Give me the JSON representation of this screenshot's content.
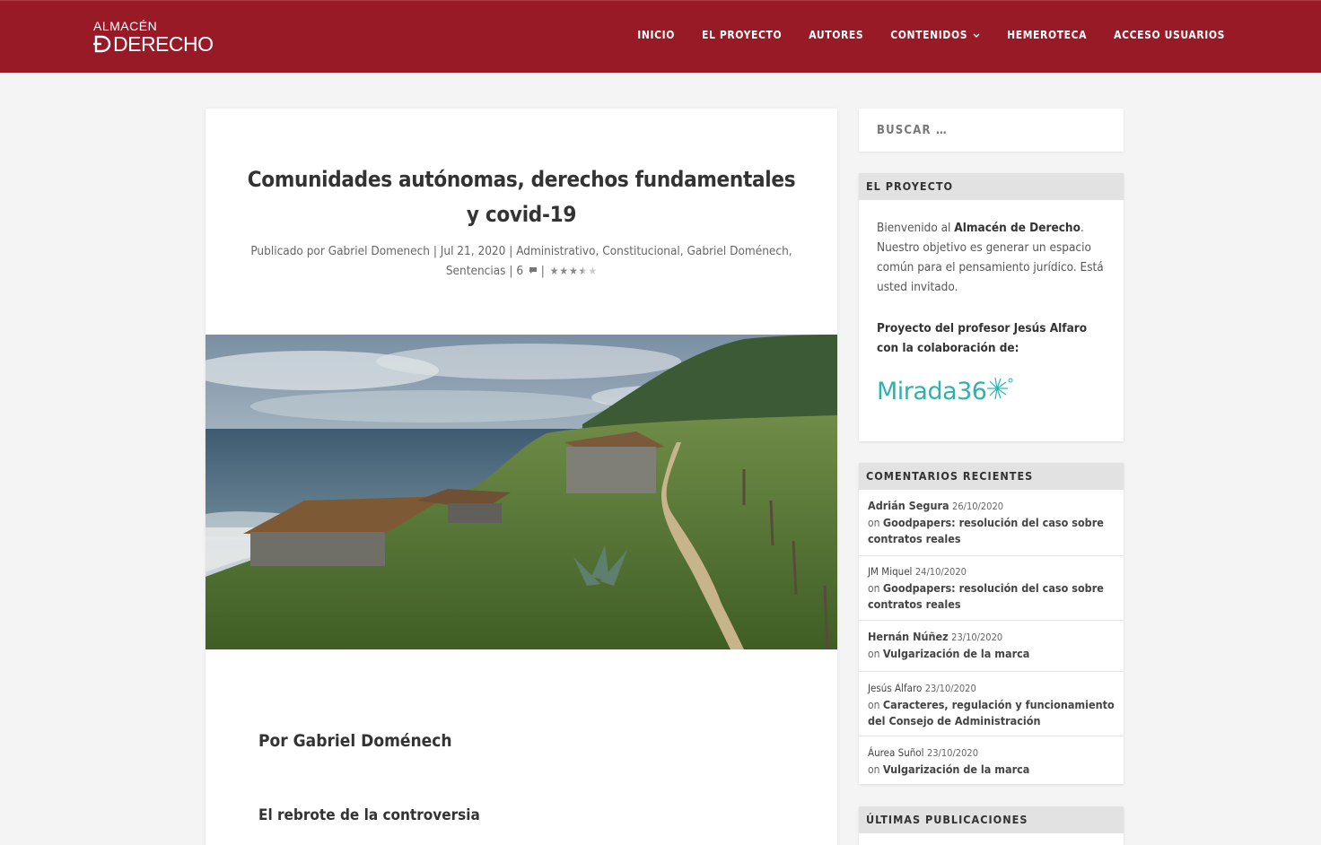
{
  "brand": {
    "line1": "ALMACÉN",
    "line2": "DERECHO",
    "color": "#981a26"
  },
  "nav": [
    {
      "label": "INICIO"
    },
    {
      "label": "EL PROYECTO"
    },
    {
      "label": "AUTORES"
    },
    {
      "label": "CONTENIDOS",
      "icon": "chevron-down-icon"
    },
    {
      "label": "HEMEROTECA"
    },
    {
      "label": "ACCESO USUARIOS"
    }
  ],
  "article": {
    "title": "Comunidades autónomas, derechos fundamentales y covid-19",
    "meta": {
      "prefix": "Publicado por ",
      "author": "Gabriel Domenech",
      "date": "Jul 21, 2020",
      "categories": [
        "Administrativo",
        "Constitucional",
        "Gabriel Doménech",
        "Sentencias"
      ],
      "comments": "6",
      "rating": 3.5,
      "rating_max": 5
    },
    "byline": "Por Gabriel Doménech",
    "subhead": "El rebrote de la controversia"
  },
  "search": {
    "placeholder": "BUSCAR …"
  },
  "widgets": {
    "proyecto": {
      "title": "EL PROYECTO",
      "intro_pre": "Bienvenido al ",
      "intro_bold": "Almacén de Derecho",
      "intro_post": ". Nuestro objetivo es generar un espacio común para el pensamiento jurídico. Está usted invitado.",
      "collab": "Proyecto del profesor Jesús Alfaro con la colaboración de:",
      "partner": "Mirada36"
    },
    "comments": {
      "title": "COMENTARIOS RECIENTES",
      "on": "on",
      "items": [
        {
          "author": "Adrián Segura",
          "date": "26/10/2020",
          "post": "Goodpapers: resolución del caso sobre contratos reales"
        },
        {
          "author": "JM Miquel",
          "date": "24/10/2020",
          "post": "Goodpapers: resolución del caso sobre contratos reales"
        },
        {
          "author": "Hernán Núñez",
          "date": "23/10/2020",
          "post": "Vulgarización de la marca"
        },
        {
          "author": "Jesús Alfaro",
          "date": "23/10/2020",
          "post": "Caracteres, regulación y funcionamiento del Consejo de Administración"
        },
        {
          "author": "Áurea Suñol",
          "date": "23/10/2020",
          "post": "Vulgarización de la marca"
        }
      ]
    },
    "latest": {
      "title": "ÚLTIMAS PUBLICACIONES"
    }
  }
}
